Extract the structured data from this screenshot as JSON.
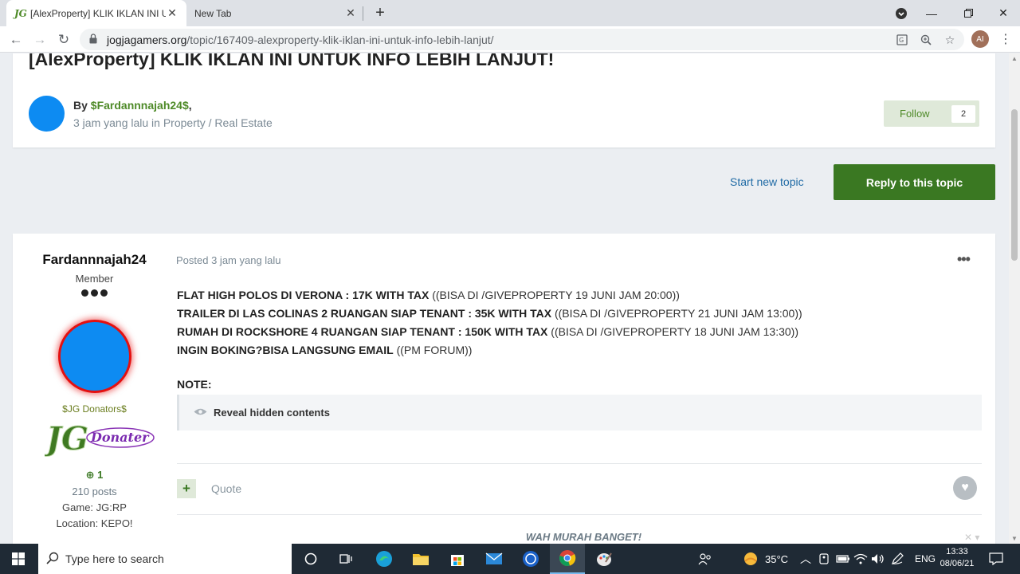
{
  "browser": {
    "tabs": [
      {
        "favicon": "JG",
        "title": "[AlexProperty] KLIK IKLAN INI UN"
      },
      {
        "title": "New Tab"
      }
    ],
    "url_host": "jogjagamers.org",
    "url_path": "/topic/167409-alexproperty-klik-iklan-ini-untuk-info-lebih-lanjut/",
    "profile_initials": "AI"
  },
  "topic": {
    "title": "[AlexProperty] KLIK IKLAN INI UNTUK INFO LEBIH LANJUT!",
    "by_label": "By",
    "author": "$Fardannnajah24$",
    "author_suffix": ",",
    "subline": "3 jam yang lalu in Property / Real Estate",
    "follow_label": "Follow",
    "follow_count": "2",
    "start_new_topic": "Start new topic",
    "reply_label": "Reply to this topic"
  },
  "post": {
    "author": "Fardannnajah24",
    "rank": "Member",
    "group": "$JG Donators$",
    "badge_text": "JG",
    "badge_script": "Donater",
    "reputation": "1",
    "post_count": "210 posts",
    "game": "Game: JG:RP",
    "location": "Location: KEPO!",
    "posted": "Posted 3 jam yang lalu",
    "lines": [
      {
        "bold": "FLAT HIGH POLOS DI VERONA : 17K WITH TAX",
        "rest": " ((BISA DI /GIVEPROPERTY 19 JUNI JAM 20:00))"
      },
      {
        "bold": "TRAILER DI LAS COLINAS 2 RUANGAN SIAP TENANT : 35K WITH TAX",
        "rest": " ((BISA DI /GIVEPROPERTY 21 JUNI JAM 13:00))"
      },
      {
        "bold": "RUMAH DI ROCKSHORE 4 RUANGAN SIAP TENANT : 150K WITH TAX",
        "rest": " ((BISA DI /GIVEPROPERTY 18 JUNI JAM 13:30))"
      },
      {
        "bold": "INGIN BOKING?BISA LANGSUNG EMAIL",
        "rest": " ((PM FORUM))"
      }
    ],
    "note": "NOTE:",
    "reveal": "Reveal hidden contents",
    "quote": "Quote",
    "signature": "WAH MURAH BANGET!"
  },
  "taskbar": {
    "search_placeholder": "Type here to search",
    "temperature": "35°C",
    "language": "ENG",
    "time": "13:33",
    "date": "08/06/21"
  },
  "colors": {
    "accent_green": "#3a7822",
    "link_blue": "#1f6aa5",
    "avatar_blue": "#0d8bf2",
    "glow_red": "#e41010"
  }
}
